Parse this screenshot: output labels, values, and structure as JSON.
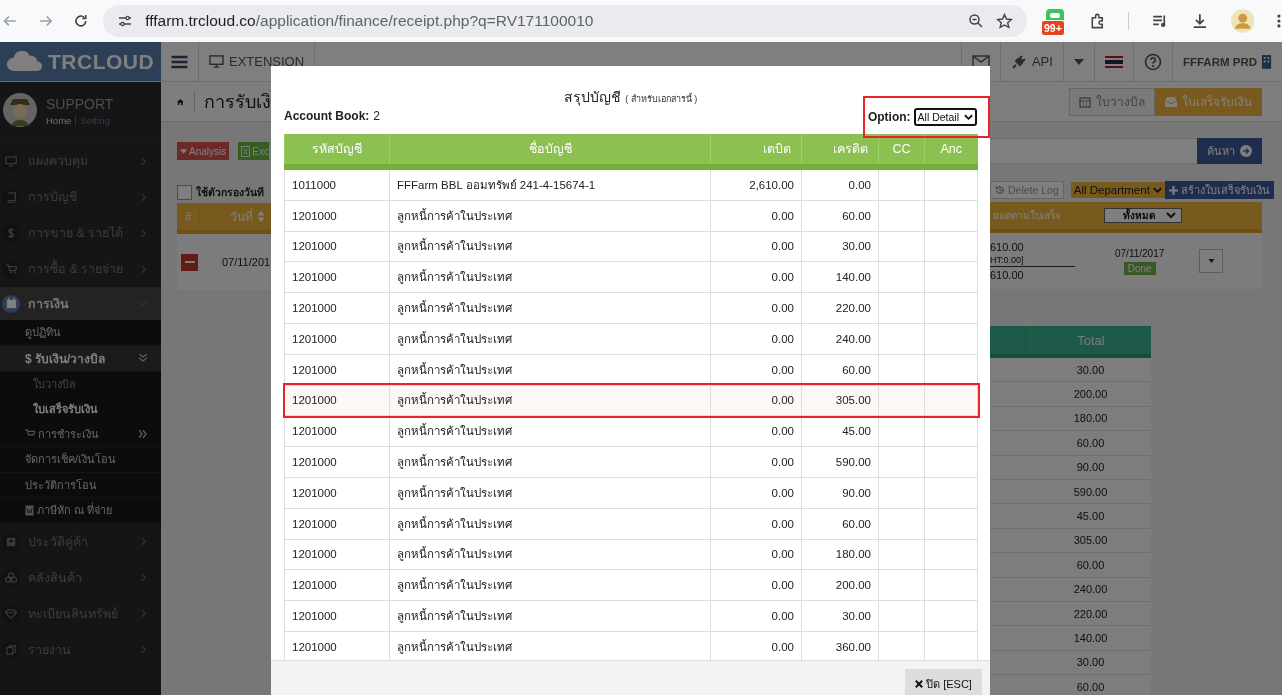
{
  "browser": {
    "url_host": "fffarm.trcloud.co",
    "url_path": "/application/finance/receipt.php?q=RV171100010",
    "extension_badge": "99+"
  },
  "header": {
    "logo": "TRCLOUD",
    "extension": "EXTENSION",
    "api": "API",
    "company": "FFFARM PRD"
  },
  "profile": {
    "name": "SUPPORT",
    "links": [
      {
        "label": "Home",
        "selected": true
      },
      {
        "label": "Setting",
        "selected": false
      }
    ]
  },
  "sidebar": {
    "items": [
      {
        "label": "แผงควบคุม",
        "expanded": false
      },
      {
        "label": "การบัญชี",
        "expanded": false
      },
      {
        "label": "การขาย & รายได้",
        "expanded": false
      },
      {
        "label": "การซื้อ & รายจ่าย",
        "expanded": false
      },
      {
        "label": "การเงิน",
        "expanded": true,
        "children": [
          {
            "label": "ดูปฏิทิน",
            "expanded": false
          },
          {
            "label": "$ รับเงิน/วางบิล",
            "expanded": true,
            "children": [
              {
                "label": "ใบวางบิล",
                "selected": false
              },
              {
                "label": "ใบเสร็จรับเงิน",
                "selected": true
              }
            ]
          },
          {
            "label": "การชำระเงิน",
            "expanded": false
          },
          {
            "label": "จัดการเช็ค/เงินโอน",
            "expanded": false
          },
          {
            "label": "ประวัติการโอน",
            "expanded": false
          },
          {
            "label": "ภาษีหัก ณ ที่จ่าย",
            "expanded": false
          }
        ]
      },
      {
        "label": "ประวัติคู่ค้า",
        "expanded": false
      },
      {
        "label": "คลังสินค้า",
        "expanded": false
      },
      {
        "label": "ทะเบียนสินทรัพย์",
        "expanded": false
      },
      {
        "label": "รายงาน",
        "expanded": false
      }
    ]
  },
  "page": {
    "title": "การรับเงิ",
    "bill_button": "ใบวางบิล",
    "receipt_button": "ใบเสร็จรับเงิน",
    "analysis_button": "Analysis",
    "excel_button": "Exc",
    "search_button": "ค้นหา",
    "date_filter": {
      "label": "ใช้ตัวกรองวันที",
      "checked": false
    },
    "delete_log_button": "Delete Log",
    "department": "All Department",
    "create_button": "สร้างใบเสร็จรับเงิน"
  },
  "receipts": {
    "columns": [
      "#",
      "วันที่",
      "ยอดตามใบเสร็จ"
    ],
    "status_filter": "ทั้งหมด",
    "rows": [
      {
        "date": "07/11/201",
        "amount": "610.00",
        "vat": "HT:0.00]",
        "total": "610.00",
        "doc_date": "07/11/2017",
        "status": "Done"
      }
    ]
  },
  "totals": {
    "header": "Total",
    "values": [
      "30.00",
      "200.00",
      "180.00",
      "60.00",
      "90.00",
      "590.00",
      "45.00",
      "305.00",
      "60.00",
      "240.00",
      "220.00",
      "140.00",
      "30.00",
      "60.00"
    ]
  },
  "dialog": {
    "title": "สรุปบัญชี",
    "subtitle": "( สำหรับเอกสารนี้ )",
    "account_book_label": "Account Book:",
    "account_book": "2",
    "option_label": "Option:",
    "option": "All Detail",
    "option_highlighted": true,
    "columns": [
      "รหัสบัญชี",
      "ชื่อบัญชี",
      "เดบิต",
      "เครดิต",
      "CC",
      "Anc"
    ],
    "rows": [
      {
        "code": "1011000",
        "name": "FFFarm BBL ออมทรัพย์ 241-4-15674-1",
        "debit": "2,610.00",
        "credit": "0.00",
        "highlighted": false
      },
      {
        "code": "1201000",
        "name": "ลูกหนี้การค้าในประเทศ",
        "debit": "0.00",
        "credit": "60.00",
        "highlighted": false
      },
      {
        "code": "1201000",
        "name": "ลูกหนี้การค้าในประเทศ",
        "debit": "0.00",
        "credit": "30.00",
        "highlighted": false
      },
      {
        "code": "1201000",
        "name": "ลูกหนี้การค้าในประเทศ",
        "debit": "0.00",
        "credit": "140.00",
        "highlighted": false
      },
      {
        "code": "1201000",
        "name": "ลูกหนี้การค้าในประเทศ",
        "debit": "0.00",
        "credit": "220.00",
        "highlighted": false
      },
      {
        "code": "1201000",
        "name": "ลูกหนี้การค้าในประเทศ",
        "debit": "0.00",
        "credit": "240.00",
        "highlighted": false
      },
      {
        "code": "1201000",
        "name": "ลูกหนี้การค้าในประเทศ",
        "debit": "0.00",
        "credit": "60.00",
        "highlighted": false
      },
      {
        "code": "1201000",
        "name": "ลูกหนี้การค้าในประเทศ",
        "debit": "0.00",
        "credit": "305.00",
        "highlighted": true
      },
      {
        "code": "1201000",
        "name": "ลูกหนี้การค้าในประเทศ",
        "debit": "0.00",
        "credit": "45.00",
        "highlighted": false
      },
      {
        "code": "1201000",
        "name": "ลูกหนี้การค้าในประเทศ",
        "debit": "0.00",
        "credit": "590.00",
        "highlighted": false
      },
      {
        "code": "1201000",
        "name": "ลูกหนี้การค้าในประเทศ",
        "debit": "0.00",
        "credit": "90.00",
        "highlighted": false
      },
      {
        "code": "1201000",
        "name": "ลูกหนี้การค้าในประเทศ",
        "debit": "0.00",
        "credit": "60.00",
        "highlighted": false
      },
      {
        "code": "1201000",
        "name": "ลูกหนี้การค้าในประเทศ",
        "debit": "0.00",
        "credit": "180.00",
        "highlighted": false
      },
      {
        "code": "1201000",
        "name": "ลูกหนี้การค้าในประเทศ",
        "debit": "0.00",
        "credit": "200.00",
        "highlighted": false
      },
      {
        "code": "1201000",
        "name": "ลูกหนี้การค้าในประเทศ",
        "debit": "0.00",
        "credit": "30.00",
        "highlighted": false
      },
      {
        "code": "1201000",
        "name": "ลูกหนี้การค้าในประเทศ",
        "debit": "0.00",
        "credit": "360.00",
        "highlighted": false
      }
    ],
    "close_button": "ปิด [ESC]"
  }
}
